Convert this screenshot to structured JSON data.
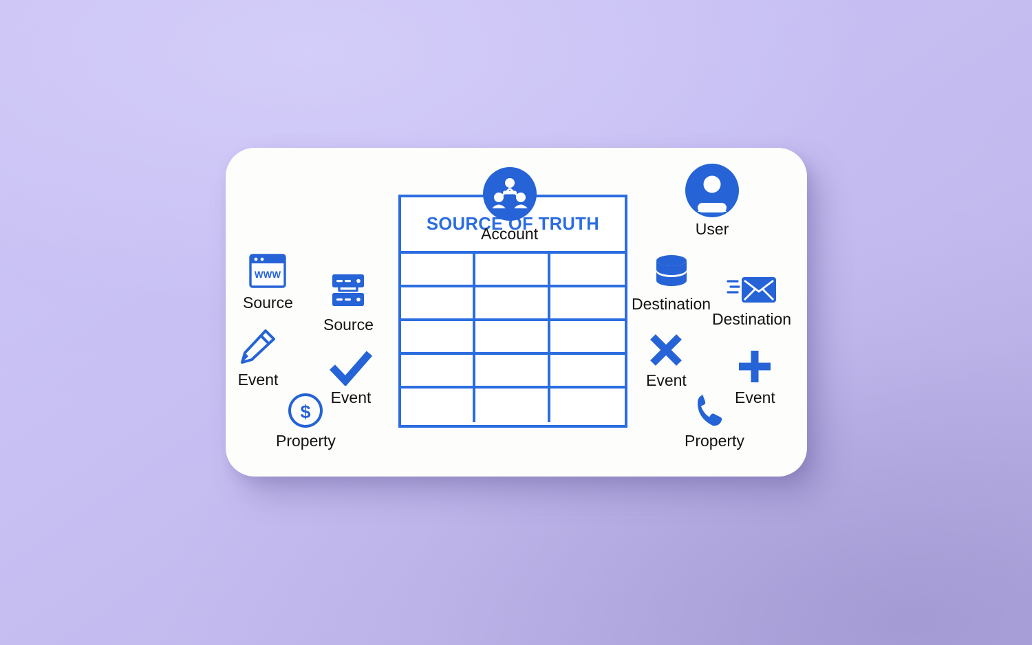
{
  "theme": {
    "background_color": "#c6bef2",
    "card_color": "#fdfdfb",
    "accent_blue": "#2b6de0",
    "icon_blue": "#2563d6",
    "label_color": "#131313"
  },
  "table": {
    "title": "SOURCE OF TRUTH",
    "columns": 3,
    "body_rows": 5,
    "cells": [
      [
        "",
        "",
        ""
      ],
      [
        "",
        "",
        ""
      ],
      [
        "",
        "",
        ""
      ],
      [
        "",
        "",
        ""
      ],
      [
        "",
        "",
        ""
      ]
    ]
  },
  "left_nodes": [
    {
      "id": "account",
      "label": "Account",
      "icon": "account-group-circle-icon"
    },
    {
      "id": "source_www",
      "label": "Source",
      "icon": "browser-window-www-icon"
    },
    {
      "id": "source_srv",
      "label": "Source",
      "icon": "server-rack-icon"
    },
    {
      "id": "event_edit",
      "label": "Event",
      "icon": "pencil-icon"
    },
    {
      "id": "event_check",
      "label": "Event",
      "icon": "checkmark-icon"
    },
    {
      "id": "property_money",
      "label": "Property",
      "icon": "dollar-circle-icon"
    }
  ],
  "right_nodes": [
    {
      "id": "user",
      "label": "User",
      "icon": "user-avatar-circle-icon"
    },
    {
      "id": "dest_db",
      "label": "Destination",
      "icon": "database-cylinder-icon"
    },
    {
      "id": "dest_mail",
      "label": "Destination",
      "icon": "envelope-send-icon"
    },
    {
      "id": "event_x",
      "label": "Event",
      "icon": "close-x-icon"
    },
    {
      "id": "event_plus",
      "label": "Event",
      "icon": "plus-icon"
    },
    {
      "id": "property_phone",
      "label": "Property",
      "icon": "phone-handset-icon"
    }
  ],
  "browser_icon": {
    "text": "WWW"
  }
}
